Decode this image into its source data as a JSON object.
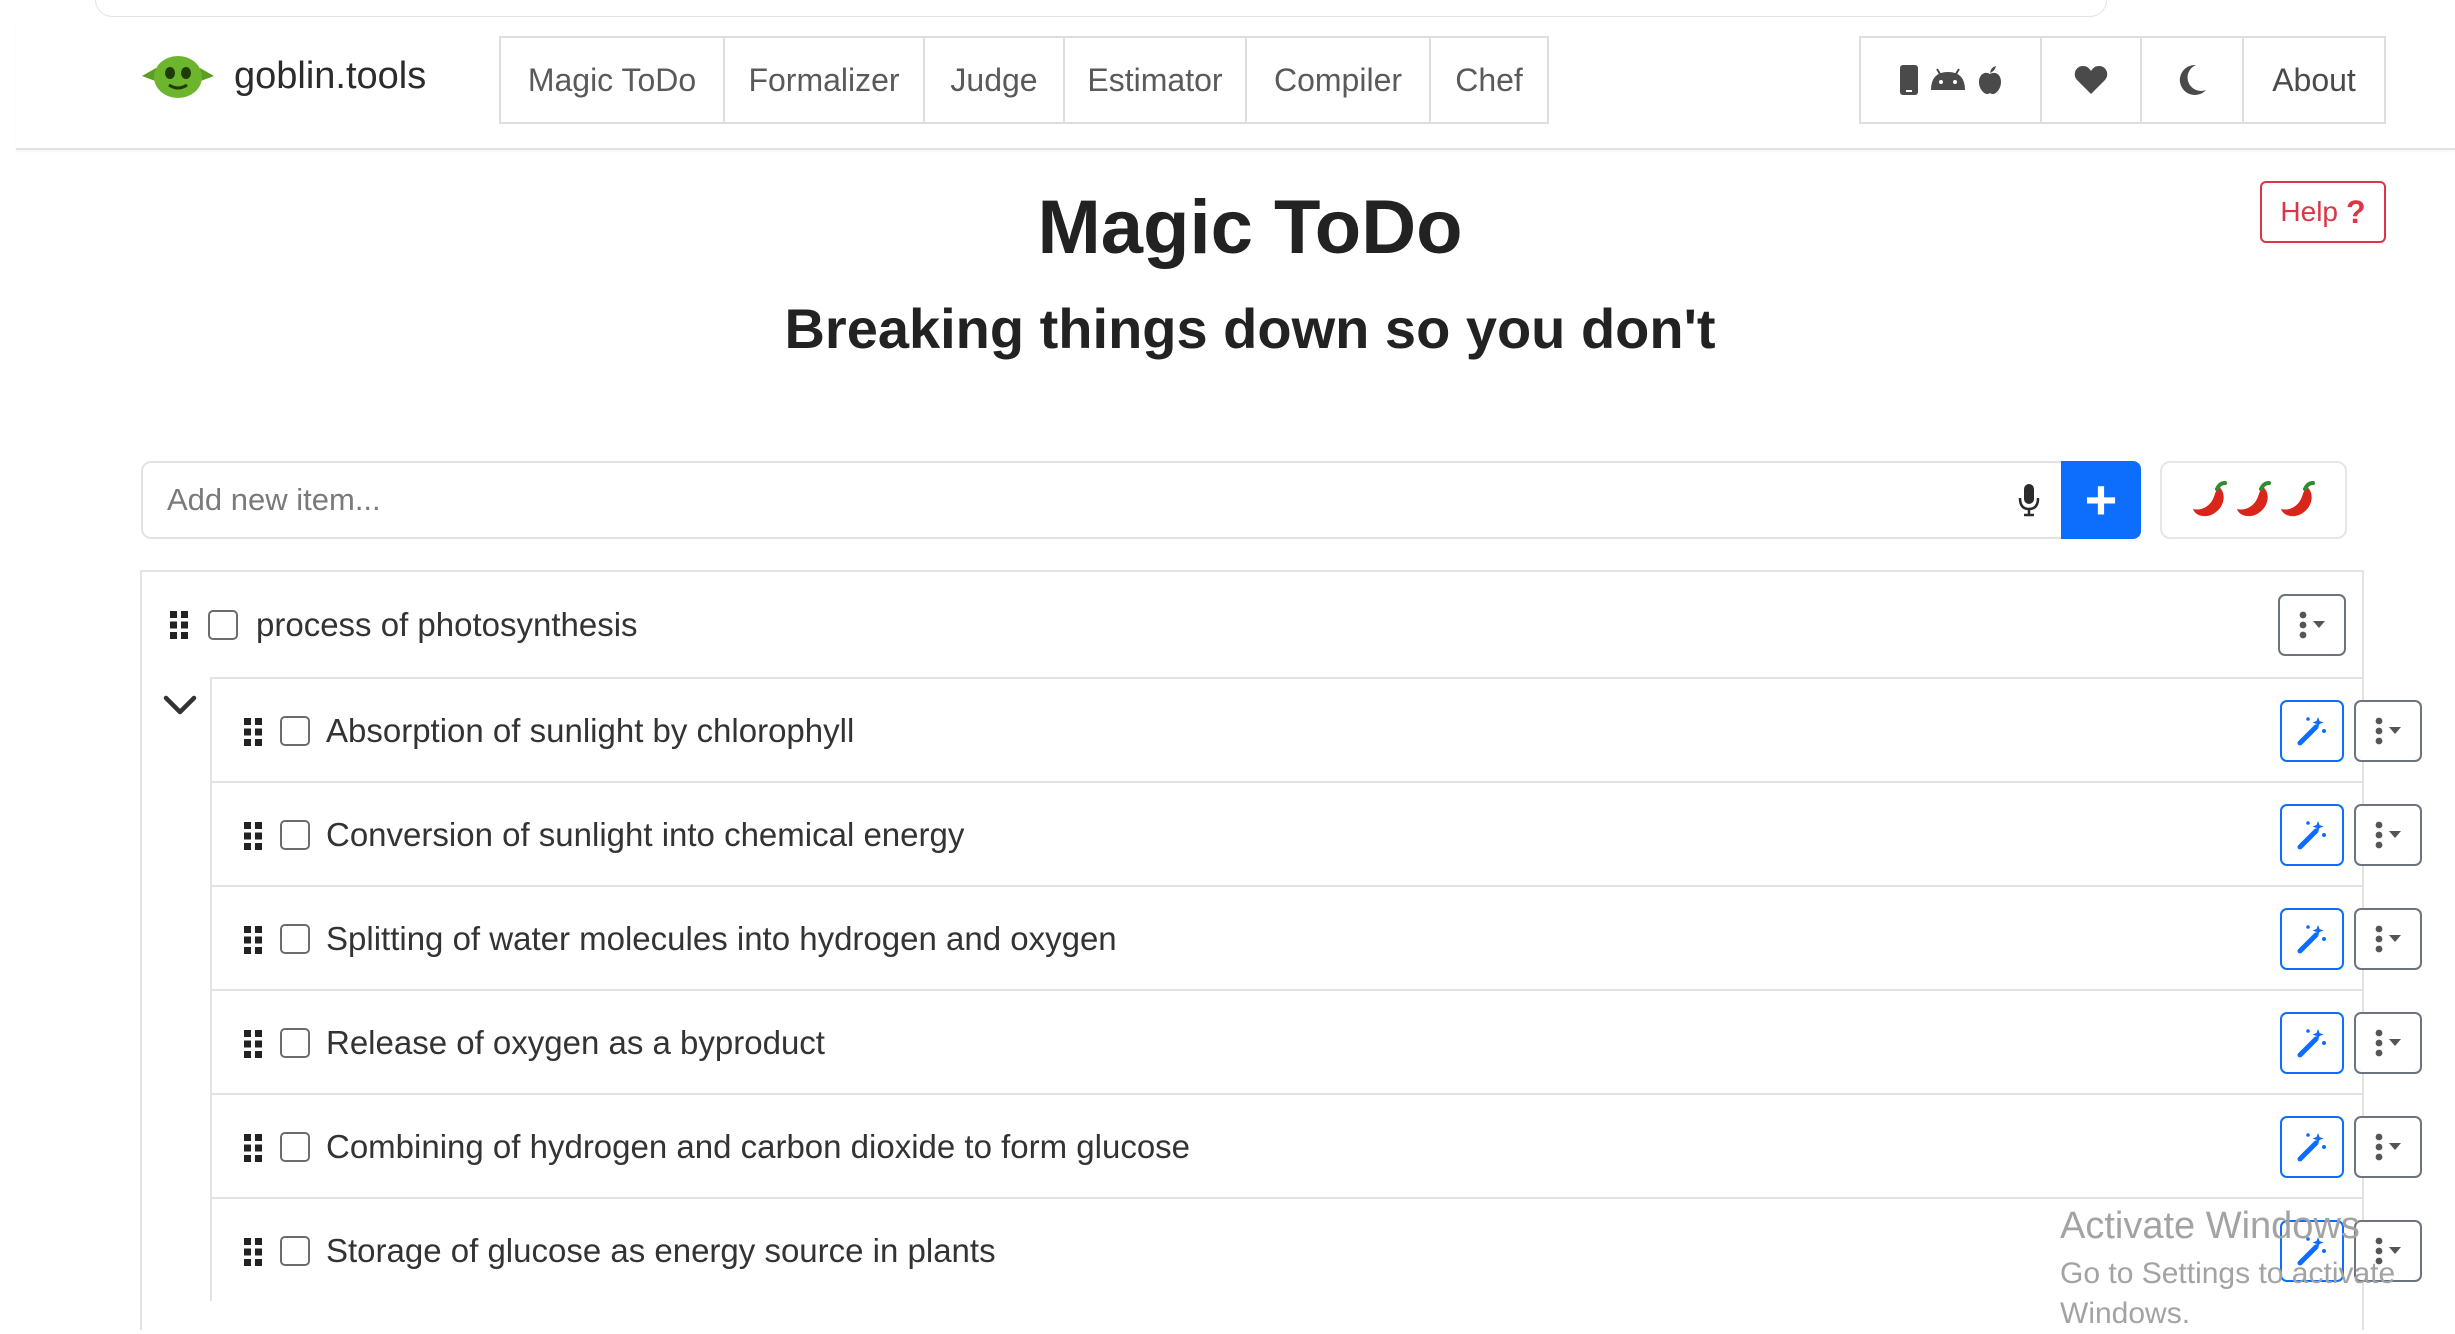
{
  "brand": {
    "name": "goblin.tools"
  },
  "nav": {
    "tabs": [
      "Magic ToDo",
      "Formalizer",
      "Judge",
      "Estimator",
      "Compiler",
      "Chef"
    ],
    "right": {
      "apps_icons": [
        "phone-icon",
        "android-icon",
        "apple-icon"
      ],
      "donate_icon": "heart-icon",
      "theme_icon": "moon-icon",
      "about_label": "About"
    }
  },
  "help": {
    "label": "Help",
    "icon": "?"
  },
  "header": {
    "title": "Magic ToDo",
    "subtitle": "Breaking things down so you don't"
  },
  "add": {
    "placeholder": "Add new item...",
    "value": "",
    "add_icon": "+",
    "spiciness_icons": [
      "chili-icon",
      "chili-icon",
      "chili-icon"
    ]
  },
  "colors": {
    "primary": "#0d6efd",
    "danger": "#dc3545",
    "chili_red": "#d8261b",
    "chili_green": "#2e8b2e"
  },
  "task": {
    "label": "process of photosynthesis",
    "checked": false,
    "expanded": true,
    "subtasks": [
      {
        "label": "Absorption of sunlight by chlorophyll",
        "checked": false
      },
      {
        "label": "Conversion of sunlight into chemical energy",
        "checked": false
      },
      {
        "label": "Splitting of water molecules into hydrogen and oxygen",
        "checked": false
      },
      {
        "label": "Release of oxygen as a byproduct",
        "checked": false
      },
      {
        "label": "Combining of hydrogen and carbon dioxide to form glucose",
        "checked": false
      },
      {
        "label": "Storage of glucose as energy source in plants",
        "checked": false
      }
    ]
  },
  "watermark": {
    "line1": "Activate Windows",
    "line2": "Go to Settings to activate Windows."
  }
}
